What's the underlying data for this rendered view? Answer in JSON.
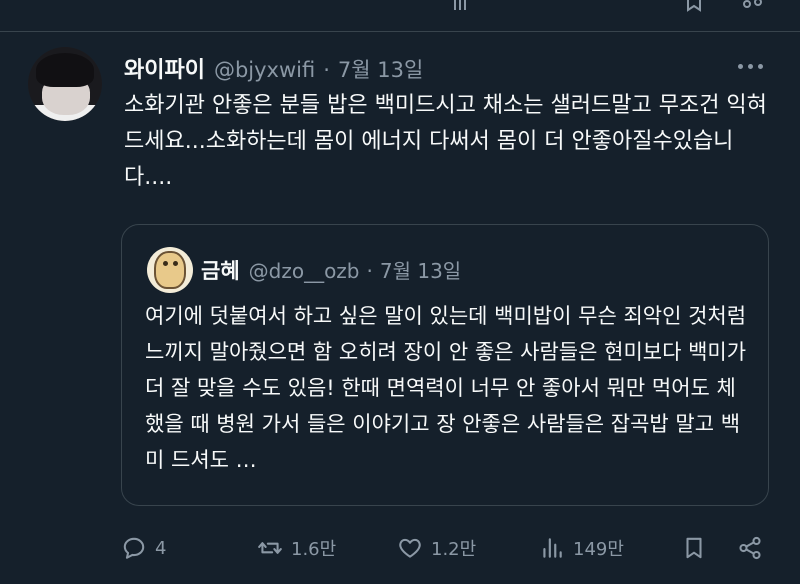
{
  "post": {
    "author": {
      "name": "와이파이",
      "handle": "@bjyxwifi"
    },
    "separator": "·",
    "date": "7월 13일",
    "text": "소화기관 안좋은 분들 밥은 백미드시고 채소는 샐러드말고 무조건 익혀드세요...소화하는데 몸이 에너지 다써서 몸이 더 안좋아질수있습니다....",
    "more_icon": "more-horizontal-icon"
  },
  "quote": {
    "author": {
      "name": "금혜",
      "handle": "@dzo__ozb"
    },
    "separator": "·",
    "date": "7월 13일",
    "text": "여기에 덧붙여서 하고 싶은 말이 있는데 백미밥이 무슨 죄악인 것처럼 느끼지 말아줬으면 함 오히려 장이 안 좋은 사람들은 현미보다 백미가 더 잘 맞을 수도 있음! 한때 면역력이 너무 안 좋아서 뭐만 먹어도 체했을 때 병원 가서 들은 이야기고 장 안좋은 사람들은 잡곡밥 말고 백미 드셔도 …"
  },
  "actions": {
    "reply": {
      "icon": "reply-icon",
      "count": "4"
    },
    "repost": {
      "icon": "repost-icon",
      "count": "1.6만"
    },
    "like": {
      "icon": "heart-icon",
      "count": "1.2만"
    },
    "views": {
      "icon": "views-icon",
      "count": "149만"
    },
    "bookmark": {
      "icon": "bookmark-icon"
    },
    "share": {
      "icon": "share-icon"
    }
  },
  "colors": {
    "background": "#15202b",
    "text": "#f7f9f9",
    "secondary": "#8b98a5",
    "border": "#38444d"
  }
}
